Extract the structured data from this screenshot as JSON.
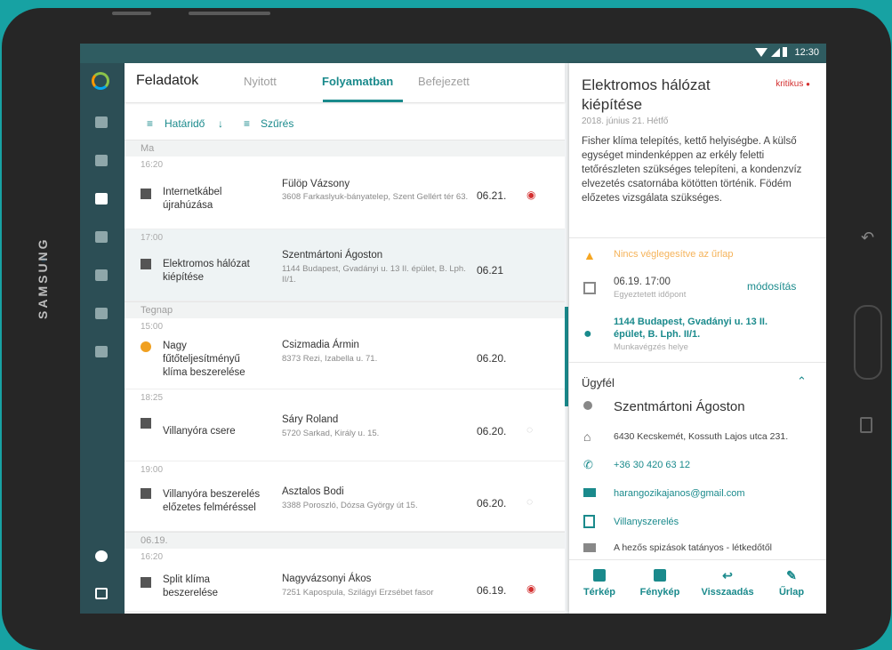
{
  "device": {
    "brand": "SAMSUNG"
  },
  "status_bar": {
    "time": "12:30"
  },
  "list": {
    "title": "Feladatok",
    "tabs": [
      {
        "label": "Nyitott"
      },
      {
        "label": "Folyamatban"
      },
      {
        "label": "Befejezett"
      }
    ],
    "active_tab": "Folyamatban",
    "sort_label": "Határidő",
    "filter_label": "Szűrés",
    "groups": [
      {
        "label": "Ma"
      },
      {
        "label": "Tegnap"
      },
      {
        "label": "06.19."
      }
    ],
    "items": [
      {
        "time": "16:20",
        "title": "Internetkábel újrahúzása",
        "name": "Fülöp Vázsony",
        "address": "3608 Farkaslyuk-bányatelep, Szent Gellért tér 63.",
        "date": "06.21."
      },
      {
        "time": "17:00",
        "title": "Elektromos hálózat kiépítése",
        "name": "Szentmártoni Ágoston",
        "address": "1144 Budapest, Gvadányi u. 13 II. épület, B. Lph. II/1.",
        "date": "06.21"
      },
      {
        "time": "15:00",
        "title": "Nagy fűtőteljesítményű klíma beszerelése",
        "name": "Csizmadia Ármin",
        "address": "8373 Rezi, Izabella u. 71.",
        "date": "06.20."
      },
      {
        "time": "18:25",
        "title": "Villanyóra csere",
        "name": "Sáry Roland",
        "address": "5720 Sarkad, Király u. 15.",
        "date": "06.20."
      },
      {
        "time": "19:00",
        "title": "Villanyóra beszerelés előzetes felméréssel",
        "name": "Asztalos Bodi",
        "address": "3388 Poroszló, Dózsa György út 15.",
        "date": "06.20."
      },
      {
        "time": "16:20",
        "title": "Split klíma beszerelése",
        "name": "Nagyvázsonyi Ákos",
        "address": "7251 Kapospula, Szilágyi Erzsébet fasor",
        "date": "06.19."
      }
    ]
  },
  "detail": {
    "title": "Elektromos hálózat kiépítése",
    "priority": "kritikus",
    "date": "2018. június 21. Hétfő",
    "description": "Fisher klíma telepítés, kettő helyiségbe. A külső egységet mindenképpen az erkély feletti tetőrészleten szükséges telepíteni, a kondenzvíz elvezetés csatornába kötötten történik. Födém előzetes vizsgálata szükséges.",
    "warning": "Nincs véglegesítve az űrlap",
    "appointment": {
      "value": "06.19. 17:00",
      "label": "Egyeztetett időpont",
      "action": "módosítás"
    },
    "location": {
      "value": "1144 Budapest, Gvadányi u. 13 II. épület, B. Lph. II/1.",
      "label": "Munkavégzés helye"
    },
    "client_section": "Ügyfél",
    "client": {
      "name": "Szentmártoni Ágoston",
      "address": "6430 Kecskemét, Kossuth Lajos utca 231.",
      "phone": "+36 30 420 63 12",
      "email": "harangozikajanos@gmail.com",
      "category": "Villanyszerelés",
      "note": "A hezős spizások tatányos - létkedőtől"
    },
    "actions": [
      {
        "label": "Térkép"
      },
      {
        "label": "Fénykép"
      },
      {
        "label": "Visszaadás"
      },
      {
        "label": "Űrlap"
      }
    ]
  }
}
